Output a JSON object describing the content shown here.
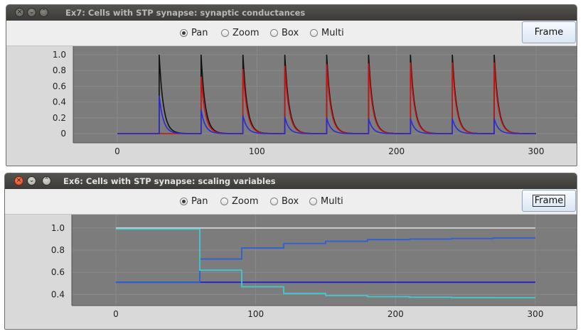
{
  "windows": [
    {
      "title": "Ex7: Cells with STP synapse: synaptic conductances",
      "active": false,
      "modes": [
        {
          "label": "Pan",
          "selected": true
        },
        {
          "label": "Zoom",
          "selected": false
        },
        {
          "label": "Box",
          "selected": false
        },
        {
          "label": "Multi",
          "selected": false
        }
      ],
      "frame_label": "Frame",
      "chart_data": {
        "type": "line",
        "xlim": [
          0,
          300
        ],
        "ylim": [
          0,
          1.0
        ],
        "x_ticks": [
          0,
          100,
          200,
          300
        ],
        "y_ticks": [
          0,
          0.2,
          0.4,
          0.6,
          0.8,
          1.0
        ],
        "x_tick_labels": [
          "0",
          "100",
          "200",
          "300"
        ],
        "y_tick_labels": [
          "0",
          "0.2",
          "0.4",
          "0.6",
          "0.8",
          "1.0"
        ],
        "grid": true,
        "spike_times": [
          30,
          60,
          90,
          120,
          150,
          180,
          210,
          240,
          270
        ],
        "decay_tau": 3,
        "series": [
          {
            "color": "#111111",
            "peaks": [
              1.0,
              1.0,
              1.0,
              1.0,
              1.0,
              1.0,
              1.0,
              1.0,
              1.0
            ]
          },
          {
            "color": "#cc1111",
            "peaks": [
              0.0,
              0.72,
              0.82,
              0.86,
              0.88,
              0.89,
              0.9,
              0.9,
              0.9
            ]
          },
          {
            "color": "#2a2ad8",
            "peaks": [
              0.48,
              0.3,
              0.23,
              0.21,
              0.2,
              0.19,
              0.19,
              0.19,
              0.19
            ]
          }
        ]
      }
    },
    {
      "title": "Ex6: Cells with STP synapse: scaling variables",
      "active": true,
      "modes": [
        {
          "label": "Pan",
          "selected": true
        },
        {
          "label": "Zoom",
          "selected": false
        },
        {
          "label": "Box",
          "selected": false
        },
        {
          "label": "Multi",
          "selected": false
        }
      ],
      "frame_label": "Frame",
      "chart_data": {
        "type": "line",
        "xlim": [
          0,
          300
        ],
        "ylim": [
          0.3,
          1.05
        ],
        "x_ticks": [
          0,
          100,
          200,
          300
        ],
        "y_ticks": [
          0.4,
          0.6,
          0.8,
          1.0
        ],
        "x_tick_labels": [
          "0",
          "100",
          "200",
          "300"
        ],
        "y_tick_labels": [
          "0.4",
          "0.6",
          "0.8",
          "1.0"
        ],
        "grid": true,
        "series": [
          {
            "color": "#d0d0d0",
            "x": [
              0,
              300
            ],
            "y": [
              1.0,
              1.0
            ]
          },
          {
            "color": "#2222cc",
            "x": [
              0,
              300
            ],
            "y": [
              0.51,
              0.51
            ]
          },
          {
            "color": "#2d5fd8",
            "x": [
              0,
              60,
              60,
              90,
              90,
              120,
              120,
              150,
              150,
              180,
              180,
              210,
              210,
              240,
              240,
              270,
              270,
              300
            ],
            "y": [
              0.51,
              0.51,
              0.72,
              0.72,
              0.82,
              0.82,
              0.86,
              0.86,
              0.88,
              0.88,
              0.895,
              0.895,
              0.9,
              0.9,
              0.905,
              0.905,
              0.91,
              0.91
            ]
          },
          {
            "color": "#3ecad0",
            "x": [
              0,
              60,
              60,
              90,
              90,
              120,
              120,
              150,
              150,
              180,
              180,
              210,
              210,
              240,
              240,
              270,
              270,
              300
            ],
            "y": [
              0.99,
              0.99,
              0.62,
              0.62,
              0.47,
              0.47,
              0.41,
              0.41,
              0.39,
              0.39,
              0.38,
              0.38,
              0.375,
              0.375,
              0.372,
              0.372,
              0.371,
              0.371
            ]
          }
        ]
      }
    }
  ]
}
